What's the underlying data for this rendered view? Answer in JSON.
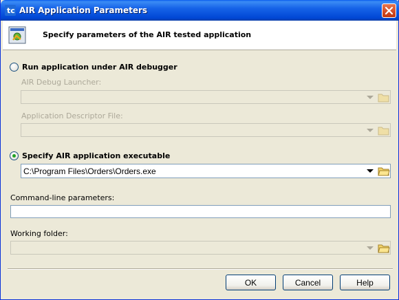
{
  "window": {
    "title": "AIR Application Parameters"
  },
  "header": {
    "text": "Specify parameters of the AIR tested application"
  },
  "options": {
    "debugger_label": "Run application under AIR debugger",
    "debug_launcher_label": "AIR Debug Launcher:",
    "debug_launcher_value": "",
    "descriptor_label": "Application Descriptor File:",
    "descriptor_value": "",
    "executable_label": "Specify AIR application executable",
    "executable_value": "C:\\Program Files\\Orders\\Orders.exe",
    "selected": "executable"
  },
  "cmdline": {
    "label": "Command-line parameters:",
    "value": ""
  },
  "working": {
    "label": "Working folder:",
    "value": ""
  },
  "buttons": {
    "ok": "OK",
    "cancel": "Cancel",
    "help": "Help"
  },
  "colors": {
    "title_bar": "#0046d4",
    "dialog_bg": "#ece9d8",
    "accent": "#21a121"
  }
}
